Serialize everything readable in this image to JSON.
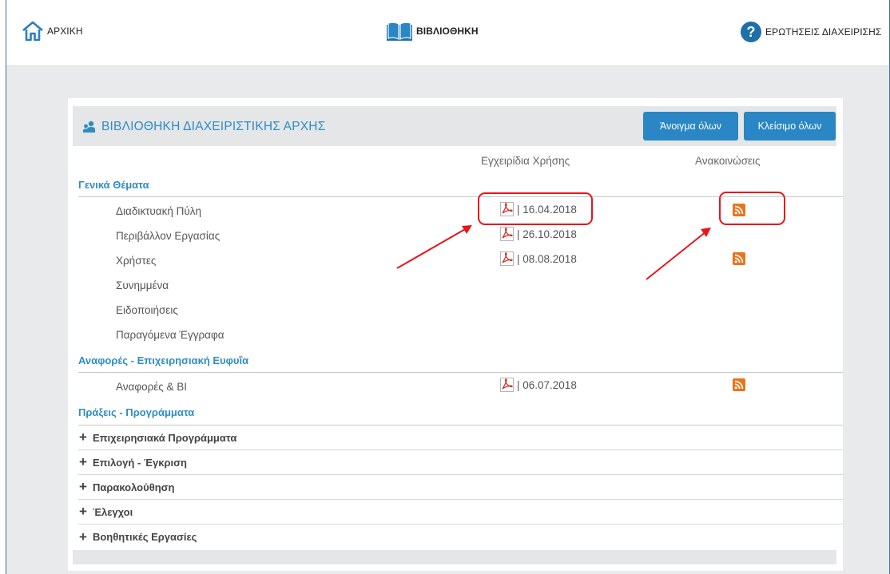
{
  "nav": {
    "home": "ΑΡΧΙΚΗ",
    "library": "ΒΙΒΛΙΟΘΗΚΗ",
    "faq": "ΕΡΩΤΗΣΕΙΣ ΔΙΑΧΕΙΡΙΣΗΣ"
  },
  "panel": {
    "title": "ΒΙΒΛΙΟΘΗΚΗ ΔΙΑΧΕΙΡΙΣΤΙΚΗΣ ΑΡΧΗΣ",
    "open_all": "Άνοιγμα όλων",
    "close_all": "Κλείσιμο όλων",
    "col_manuals": "Εγχειρίδια Χρήσης",
    "col_announcements": "Ανακοινώσεις"
  },
  "sections": {
    "general": {
      "title": "Γενικά Θέματα",
      "items": [
        {
          "label": "Διαδικτυακή Πύλη",
          "manual": "| 16.04.2018",
          "rss": true
        },
        {
          "label": "Περιβάλλον Εργασίας",
          "manual": "| 26.10.2018",
          "rss": false
        },
        {
          "label": "Χρήστες",
          "manual": "| 08.08.2018",
          "rss": true
        },
        {
          "label": "Συνημμένα",
          "manual": "",
          "rss": false
        },
        {
          "label": "Ειδοποιήσεις",
          "manual": "",
          "rss": false
        },
        {
          "label": "Παραγόμενα Έγγραφα",
          "manual": "",
          "rss": false
        }
      ]
    },
    "reports": {
      "title": "Αναφορές - Επιχειρησιακή Ευφυΐα",
      "items": [
        {
          "label": "Αναφορές & BI",
          "manual": "| 06.07.2018",
          "rss": true
        }
      ]
    },
    "actions": {
      "title": "Πράξεις - Προγράμματα",
      "groups": [
        "Επιχειρησιακά Προγράμματα",
        "Επιλογή - Έγκριση",
        "Παρακολούθηση",
        "Έλεγχοι",
        "Βοηθητικές Εργασίες"
      ]
    }
  },
  "icons": {
    "home": "home-icon",
    "library": "open-book-icon",
    "faq": "question-circle-icon",
    "title": "org-users-icon",
    "manual": "pdf-icon",
    "announcement": "rss-icon",
    "group": "plus-icon"
  },
  "colors": {
    "accent": "#2f8cc4",
    "button": "#2a86c4",
    "rss": "#e8741c",
    "pdf": "#d3342a",
    "annotation": "#e8141c"
  }
}
